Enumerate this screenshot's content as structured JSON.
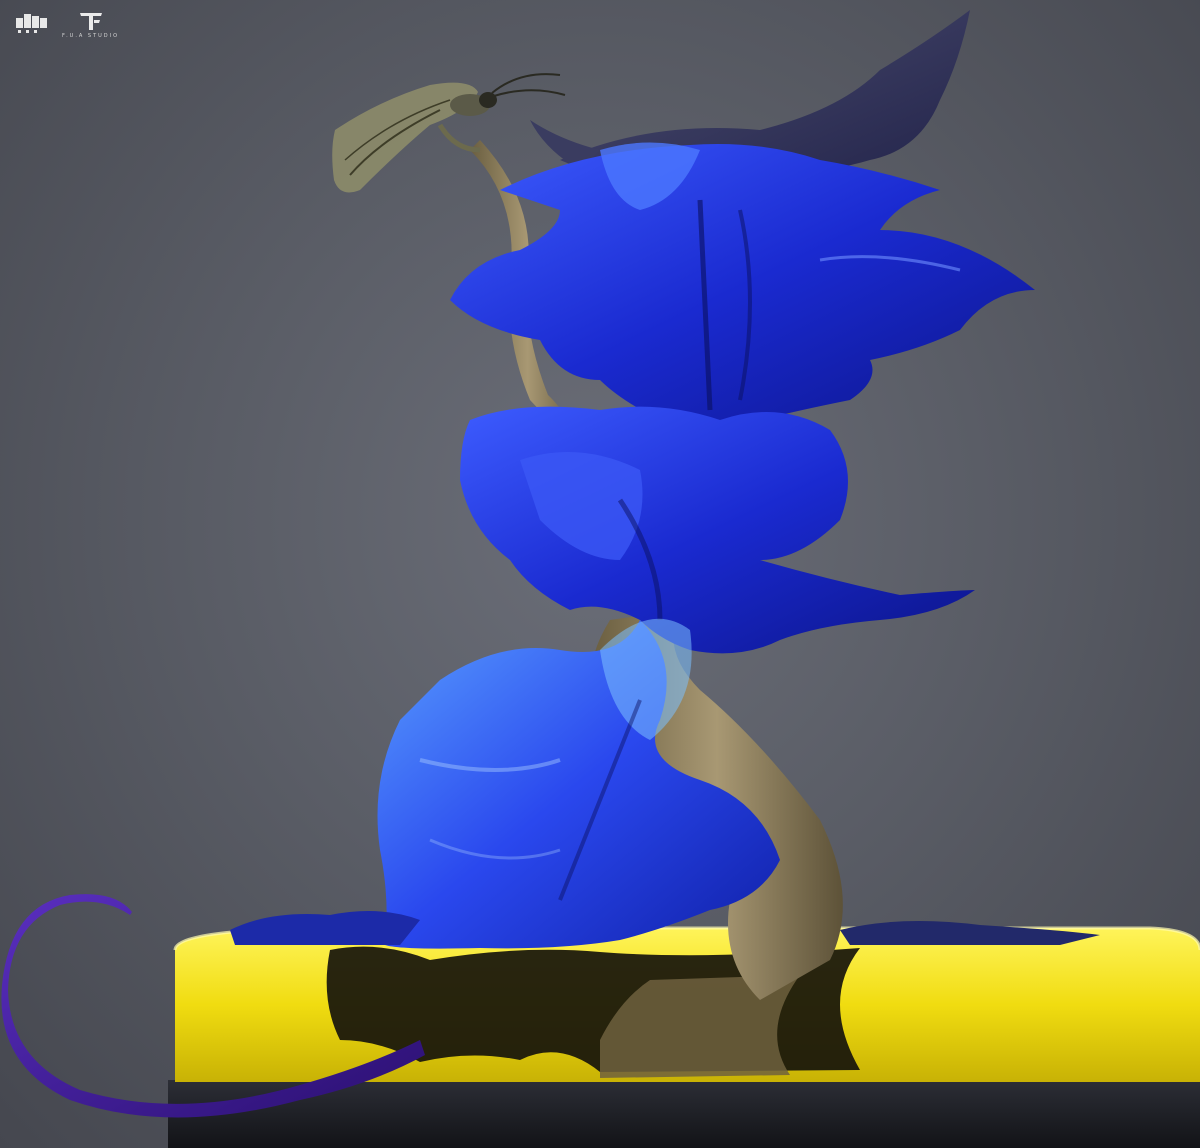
{
  "watermark": {
    "studio_name": "F.U.A STUDIO"
  },
  "colors": {
    "background": "#5a5d66",
    "petal_blue": "#1f2fd6",
    "petal_highlight": "#4a8cff",
    "stem_tan": "#8a7a55",
    "resin_yellow": "#f2e01a",
    "tail_purple": "#3d1b8c",
    "base_dark": "#1c1d22"
  },
  "subject": {
    "elements": [
      "blue-petal-sculpture",
      "insect",
      "tan-stem",
      "purple-tail",
      "yellow-resin-base"
    ]
  }
}
